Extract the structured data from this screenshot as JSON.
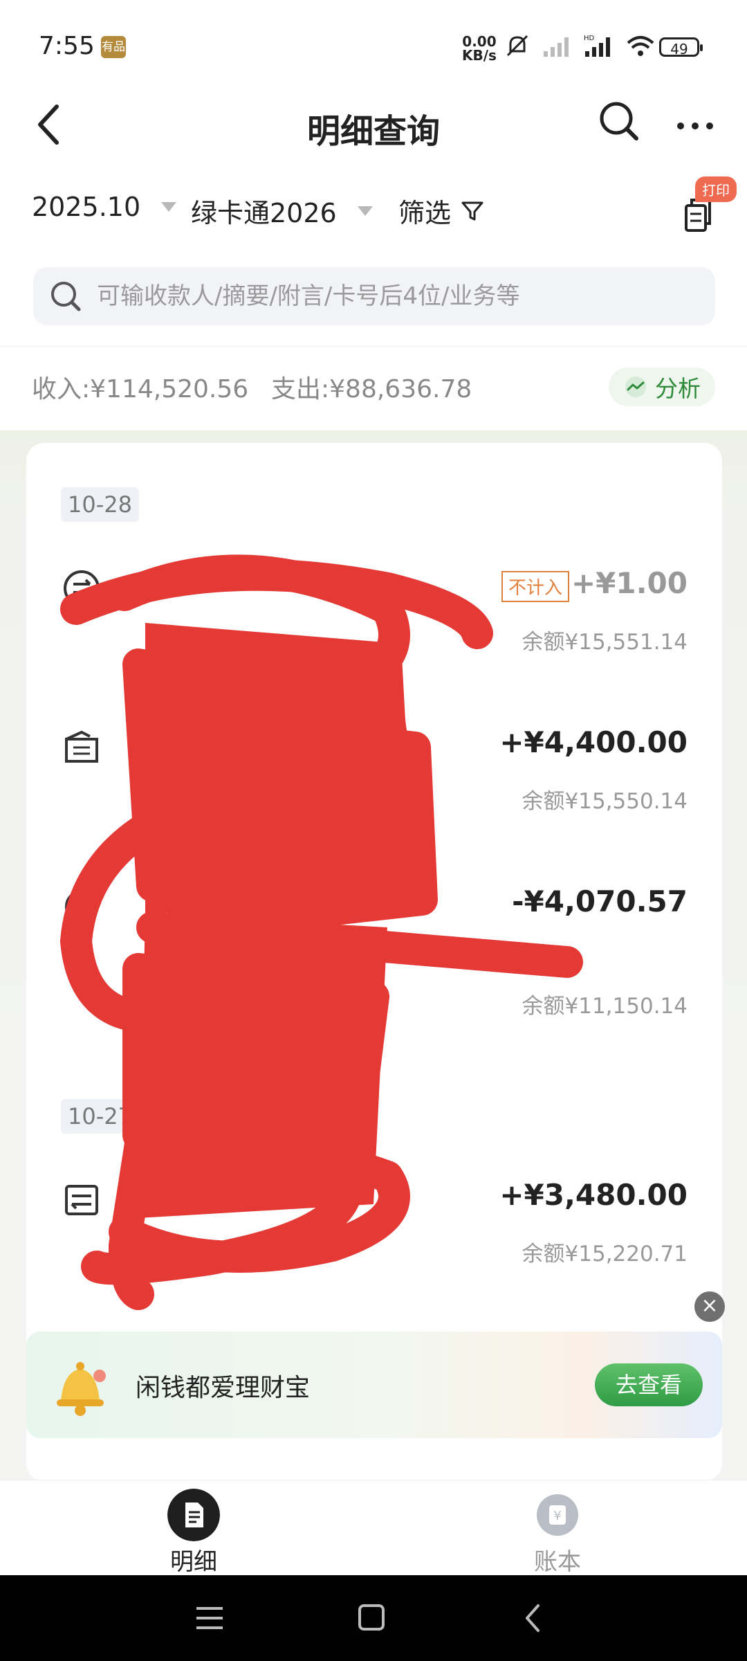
{
  "status_bar": {
    "time": "7:55",
    "badge": "有品",
    "net_speed_top": "0.00",
    "net_speed_bottom": "KB/s",
    "battery": "49"
  },
  "header": {
    "title": "明细查询"
  },
  "filters": {
    "month": "2025.10",
    "card": "绿卡通2026",
    "filter_label": "筛选",
    "print_tag": "打印"
  },
  "search": {
    "placeholder": "可输收款人/摘要/附言/卡号后4位/业务等"
  },
  "summary": {
    "income": "收入:¥114,520.56",
    "expense": "支出:¥88,636.78",
    "analyze_label": "分析"
  },
  "dates": [
    "10-28",
    "10-27"
  ],
  "transactions": [
    {
      "name": "",
      "sub": "",
      "tag": "不计入",
      "amount": "+¥1.00",
      "balance": "余额¥15,551.14"
    },
    {
      "name": "",
      "sub": "",
      "tag": "",
      "amount": "+¥4,400.00",
      "balance": "余额¥15,550.14"
    },
    {
      "name": "",
      "sub": "",
      "tag": "",
      "amount": "-¥4,070.57",
      "balance": "余额¥11,150.14"
    },
    {
      "name": "",
      "sub": "",
      "tag": "",
      "amount": "+¥3,480.00",
      "balance": "余额¥15,220.71"
    }
  ],
  "banner": {
    "text": "闲钱都爱理财宝",
    "button": "去查看",
    "close": "×"
  },
  "tabs": [
    {
      "label": "明细",
      "active": true
    },
    {
      "label": "账本",
      "active": false
    }
  ],
  "colors": {
    "accent_green": "#2f9c45",
    "tag_orange": "#e2813d",
    "scribble_red": "#e53935"
  }
}
